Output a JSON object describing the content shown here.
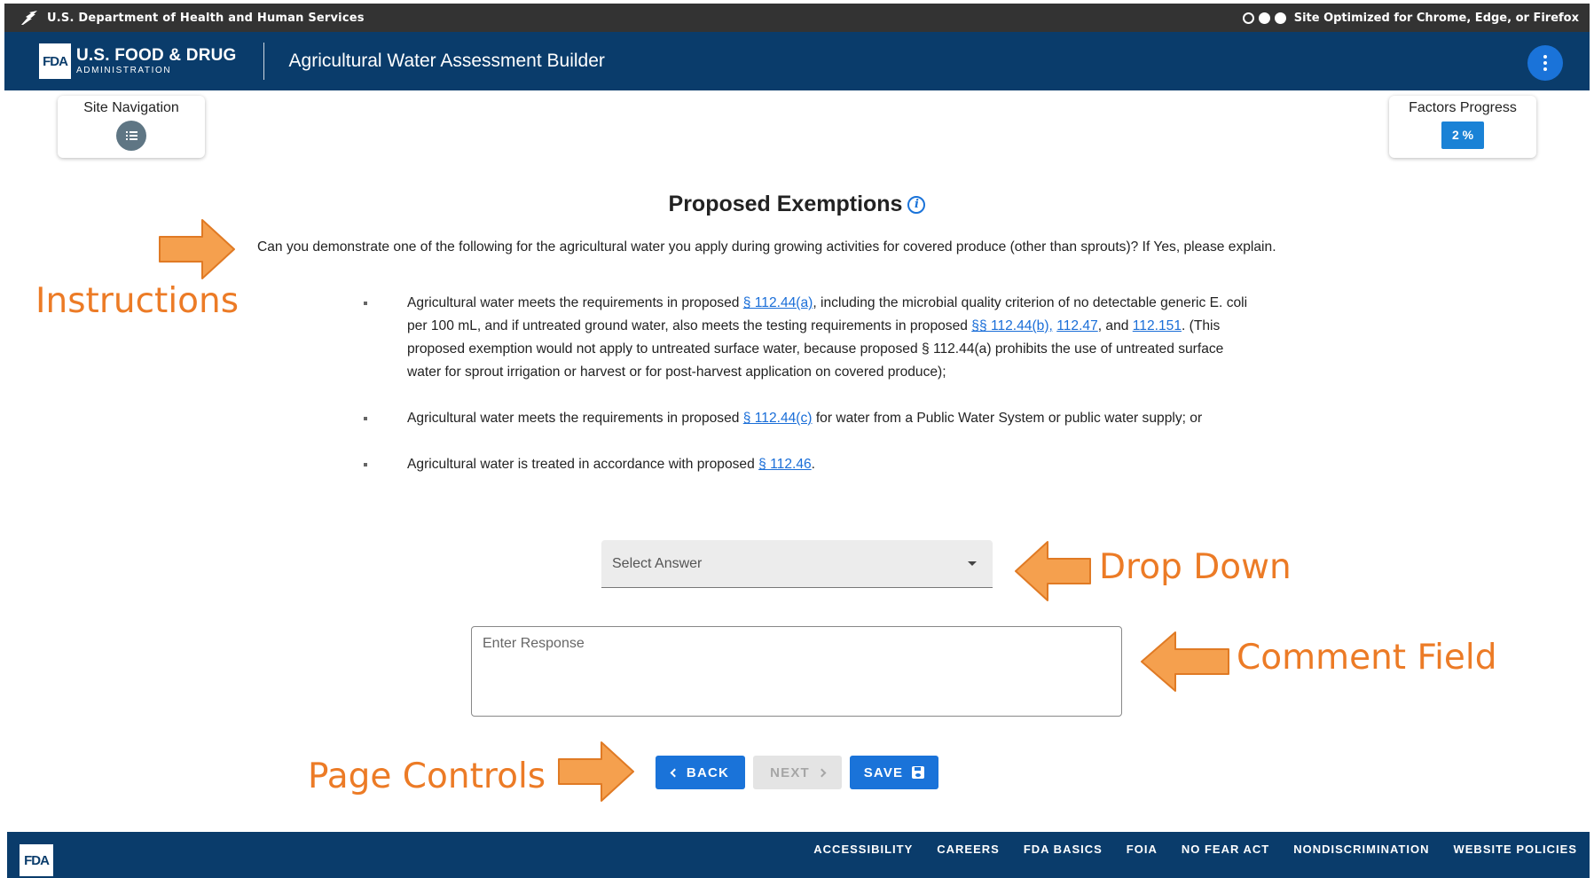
{
  "hhs_bar": {
    "agency": "U.S. Department of Health and Human Services",
    "browser_notice": "Site Optimized for Chrome, Edge, or Firefox"
  },
  "header": {
    "logo_mark": "FDA",
    "logo_line1": "U.S. FOOD & DRUG",
    "logo_line2": "ADMINISTRATION",
    "app_title": "Agricultural Water Assessment Builder",
    "menu_icon": "more-vertical-icon"
  },
  "site_nav": {
    "label": "Site Navigation",
    "icon": "list-icon"
  },
  "factors_progress": {
    "label": "Factors Progress",
    "value_label": "2 %",
    "percent": 2
  },
  "main": {
    "title": "Proposed Exemptions",
    "question": "Can you demonstrate one of the following for the agricultural water you apply during growing activities for covered produce (other than sprouts)? If Yes, please explain.",
    "bullets": [
      {
        "t1": "Agricultural water meets the requirements in proposed ",
        "l1": "§ 112.44(a)",
        "t2": ", including the microbial quality criterion of no detectable generic E. coli per 100 mL, and if untreated ground water, also meets the testing requirements in proposed ",
        "l2": "§§ 112.44(b),",
        "t3": " ",
        "l3": "112.47",
        "t4": ", and ",
        "l4": "112.151",
        "t5": ". (This proposed exemption would not apply to untreated surface water, because proposed § 112.44(a) prohibits the use of untreated surface water for sprout irrigation or harvest or for post-harvest application on covered produce);"
      },
      {
        "t1": "Agricultural water meets the requirements in proposed ",
        "l1": "§ 112.44(c)",
        "t2": " for water from a Public Water System or public water supply; or"
      },
      {
        "t1": "Agricultural water is treated in accordance with proposed ",
        "l1": "§ 112.46",
        "t2": "."
      }
    ],
    "select_placeholder": "Select Answer",
    "response_placeholder": "Enter Response"
  },
  "controls": {
    "back_label": "BACK",
    "next_label": "NEXT",
    "save_label": "SAVE"
  },
  "annotations": {
    "instructions": "Instructions",
    "drop_down": "Drop Down",
    "comment_field": "Comment Field",
    "page_controls": "Page Controls",
    "color": "#ec7b26"
  },
  "footer": {
    "logo_mark": "FDA",
    "links": [
      "ACCESSIBILITY",
      "CAREERS",
      "FDA BASICS",
      "FOIA",
      "NO FEAR ACT",
      "NONDISCRIMINATION",
      "WEBSITE POLICIES"
    ]
  },
  "colors": {
    "header_bg": "#0a3c6b",
    "hhs_bar_bg": "#333333",
    "primary_button": "#1a73d9",
    "link": "#1a6ed8",
    "progress_badge": "#1a82d6"
  }
}
